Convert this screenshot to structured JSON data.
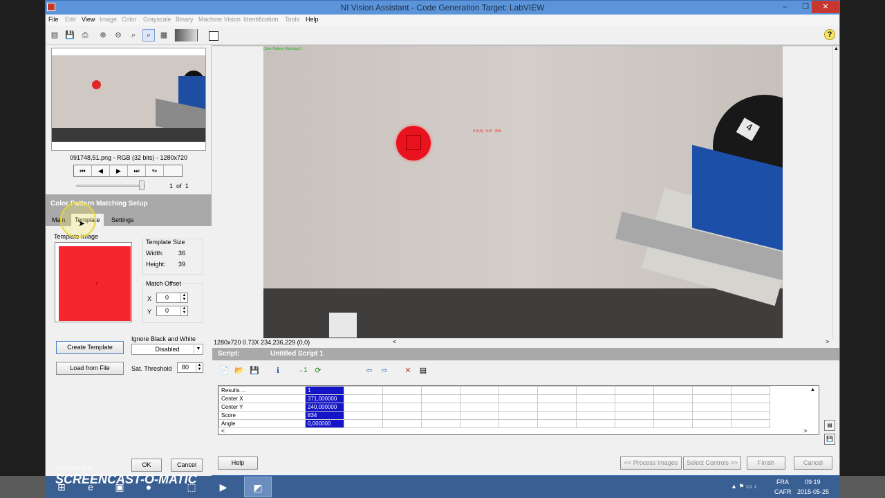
{
  "window": {
    "title": "NI Vision Assistant - Code Generation Target: LabVIEW"
  },
  "menu": [
    "File",
    "Edit",
    "View",
    "Image",
    "Color",
    "Grayscale",
    "Binary",
    "Machine Vision",
    "Identification",
    "Tools",
    "Help"
  ],
  "browser": {
    "file_info": "091748,51.png - RGB (32 bits) - 1280x720",
    "page_current": "1",
    "page_of": "of",
    "page_total": "1"
  },
  "setup": {
    "title": "Color Pattern Matching Setup",
    "tabs": [
      "Main",
      "Template",
      "Settings"
    ],
    "template_image_label": "Template Image",
    "template_size_label": "Template Size",
    "width_label": "Width:",
    "width_value": "36",
    "height_label": "Height:",
    "height_value": "39",
    "match_offset_label": "Match Offset",
    "x_label": "X",
    "x_value": "0",
    "y_label": "Y",
    "y_value": "0",
    "create_template": "Create Template",
    "load_from_file": "Load from File",
    "ignore_bw_label": "Ignore Black and White",
    "ignore_bw_value": "Disabled",
    "sat_threshold_label": "Sat. Threshold",
    "sat_threshold_value": "80",
    "ok": "OK",
    "cancel": "Cancel"
  },
  "viewer": {
    "overlay_label": "Color Pattern Matching 1",
    "match_label": "0 (0,0) - 0.0° - 834",
    "status": "1280x720 0.73X 234,236,229   (0,0)"
  },
  "script": {
    "label": "Script:",
    "name": "Untitled Script 1",
    "run_count": "1"
  },
  "results": {
    "rows": [
      {
        "label": "Results ...",
        "value": "1"
      },
      {
        "label": "Center X",
        "value": "371,000000"
      },
      {
        "label": "Center Y",
        "value": "240,000000"
      },
      {
        "label": "Score",
        "value": "834"
      },
      {
        "label": "Angle",
        "value": "0,000000"
      }
    ]
  },
  "footer": {
    "help": "Help",
    "process_images": "<< Process Images",
    "select_controls": "Select Controls >>",
    "finish": "Finish",
    "cancel": "Cancel"
  },
  "taskbar": {
    "lang_top": "FRA",
    "lang_bottom": "CAFR",
    "time": "09:19",
    "date": "2015-05-25"
  },
  "watermark": {
    "recorded_with": "Recorded with",
    "logo": "SCREENCAST-O-MATIC"
  },
  "colors": {
    "title_bar": "#5b94d8",
    "selection_blue": "#1414c8",
    "template_red": "#f5262e",
    "section_gray": "#a9a9a9"
  }
}
